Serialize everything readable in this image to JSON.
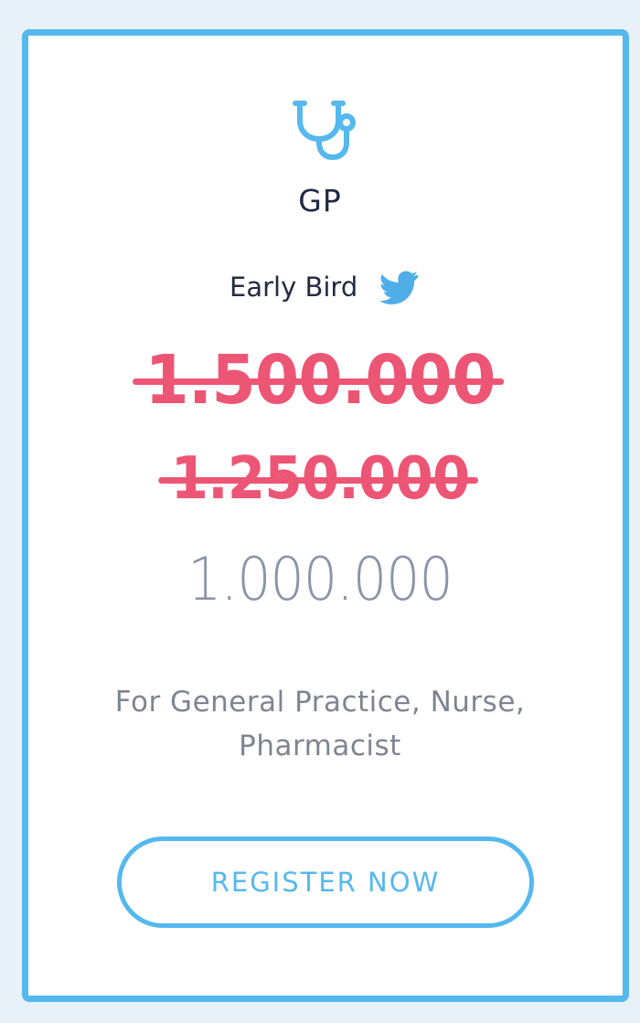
{
  "plan": {
    "title": "GP",
    "badge_label": "Early Bird",
    "icon": "stethoscope-icon",
    "badge_icon": "twitter-bird-icon"
  },
  "prices": {
    "original": "1.500.000",
    "discounted": "1.250.000",
    "current": "1.000.000"
  },
  "description": {
    "line_1": "For General Practice, Nurse,",
    "line_2": "Pharmacist"
  },
  "action": {
    "register_label": "REGISTER NOW"
  },
  "colors": {
    "accent": "#55b8ee",
    "strikethrough_price": "#ed5575",
    "current_price": "#8d94a9",
    "heading": "#202842",
    "description": "#7f8590"
  }
}
